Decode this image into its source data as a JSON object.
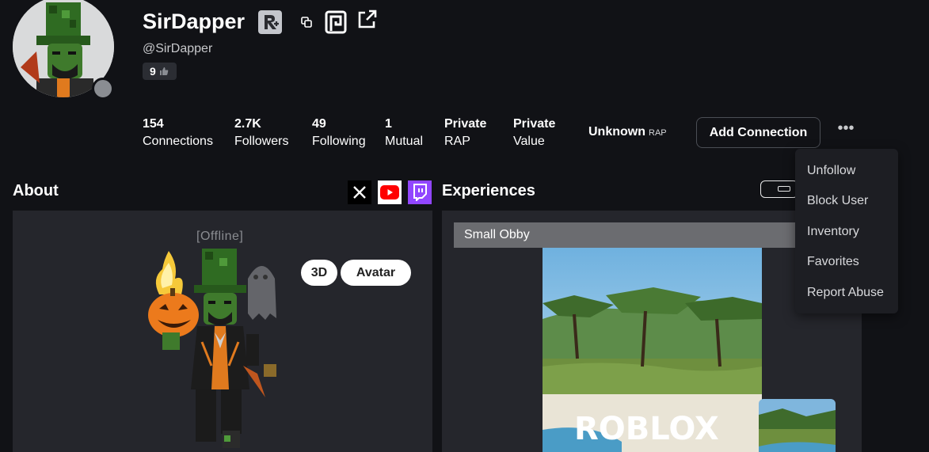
{
  "profile": {
    "display_name": "SirDapper",
    "handle": "@SirDapper",
    "badge_count": "9",
    "status": "offline"
  },
  "stats": [
    {
      "value": "154",
      "label": "Connections"
    },
    {
      "value": "2.7K",
      "label": "Followers"
    },
    {
      "value": "49",
      "label": "Following"
    },
    {
      "value": "1",
      "label": "Mutual"
    },
    {
      "value": "Private",
      "label": "RAP"
    },
    {
      "value": "Private",
      "label": "Value"
    }
  ],
  "unknown_rap": {
    "value": "Unknown",
    "label": "RAP"
  },
  "actions": {
    "add_connection": "Add Connection",
    "more": "•••"
  },
  "dropdown": {
    "items": [
      "Unfollow",
      "Block User",
      "Inventory",
      "Favorites",
      "Report Abuse"
    ]
  },
  "about": {
    "title": "About",
    "status_text": "[Offline]",
    "btn_3d": "3D",
    "btn_avatar": "Avatar",
    "socials": [
      "x-icon",
      "youtube-icon",
      "twitch-icon"
    ]
  },
  "experiences": {
    "title": "Experiences",
    "game_title": "Small Obby",
    "logo_text": "ROBLOX"
  },
  "colors": {
    "bg": "#111216",
    "panel": "#25262c",
    "youtube": "#ff0000",
    "twitch": "#9146ff"
  }
}
